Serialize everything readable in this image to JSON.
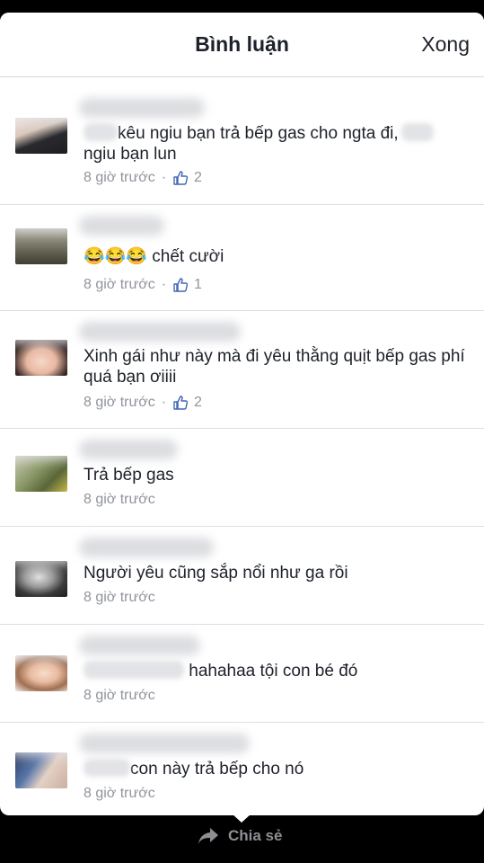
{
  "header": {
    "title": "Bình luận",
    "done_label": "Xong"
  },
  "comments": [
    {
      "text": "kêu ngiu bạn trả bếp gas cho ngta đi,",
      "text2": "ngiu bạn lun",
      "time": "8 giờ trước",
      "likes": "2"
    },
    {
      "text": "chết cười",
      "emoji": "😂😂😂",
      "time": "8 giờ trước",
      "likes": "1"
    },
    {
      "text": "Xinh gái như này mà đi yêu thằng quịt bếp gas phí quá bạn ơiiii",
      "time": "8 giờ trước",
      "likes": "2"
    },
    {
      "text": "Trả bếp gas",
      "time": "8 giờ trước"
    },
    {
      "text": "Người yêu cũng sắp nổi như ga rồi",
      "time": "8 giờ trước"
    },
    {
      "text": "hahahaa tội con bé đó",
      "time": "8 giờ trước"
    },
    {
      "text": "con này trả bếp cho nó",
      "time": "8 giờ trước"
    }
  ],
  "meta": {
    "separator": "·"
  },
  "footer": {
    "share_label": "Chia sẻ"
  },
  "icons": {
    "like": "thumbs-up-icon",
    "share": "share-arrow-icon"
  },
  "colors": {
    "like_blue": "#4267b2",
    "meta_gray": "#90949c"
  }
}
